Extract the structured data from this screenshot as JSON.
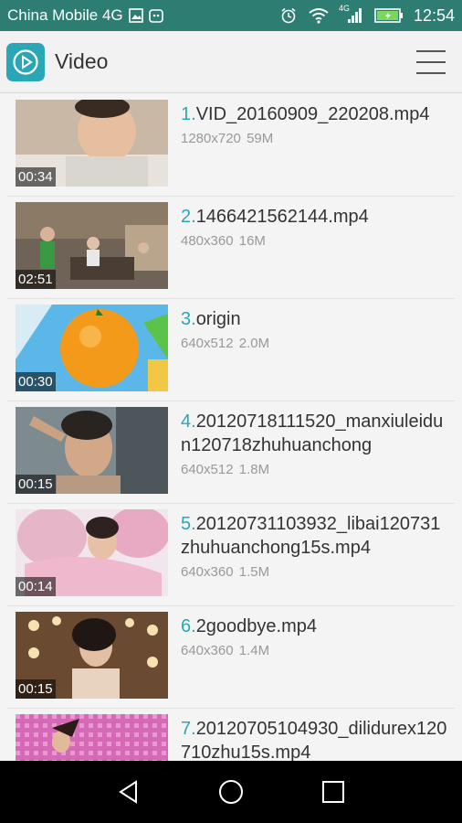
{
  "status_bar": {
    "carrier": "China Mobile 4G",
    "network": "4G",
    "time": "12:54"
  },
  "app_bar": {
    "title": "Video"
  },
  "videos": [
    {
      "index": "1.",
      "name": "VID_20160909_220208.mp4",
      "resolution": "1280x720",
      "size": "59M",
      "duration": "00:34",
      "thumb_color": "#c9b8a6"
    },
    {
      "index": "2.",
      "name": "1466421562144.mp4",
      "resolution": "480x360",
      "size": "16M",
      "duration": "02:51",
      "thumb_color": "#6f6256"
    },
    {
      "index": "3.",
      "name": "origin",
      "resolution": "640x512",
      "size": "2.0M",
      "duration": "00:30",
      "thumb_color": "#5bb7e8"
    },
    {
      "index": "4.",
      "name": "20120718111520_manxiuleidun120718zhuhuanchong",
      "resolution": "640x512",
      "size": "1.8M",
      "duration": "00:15",
      "thumb_color": "#7d8a90"
    },
    {
      "index": "5.",
      "name": "20120731103932_libai120731zhuhuanchong15s.mp4",
      "resolution": "640x360",
      "size": "1.5M",
      "duration": "00:14",
      "thumb_color": "#e6b5c8"
    },
    {
      "index": "6.",
      "name": "2goodbye.mp4",
      "resolution": "640x360",
      "size": "1.4M",
      "duration": "00:15",
      "thumb_color": "#6b4a32"
    },
    {
      "index": "7.",
      "name": "20120705104930_dilidurex120710zhu15s.mp4",
      "resolution": "",
      "size": "",
      "duration": "",
      "thumb_color": "#d46ab6"
    }
  ],
  "colors": {
    "status_bar": "#2e7d73",
    "accent": "#2aa7b6"
  }
}
